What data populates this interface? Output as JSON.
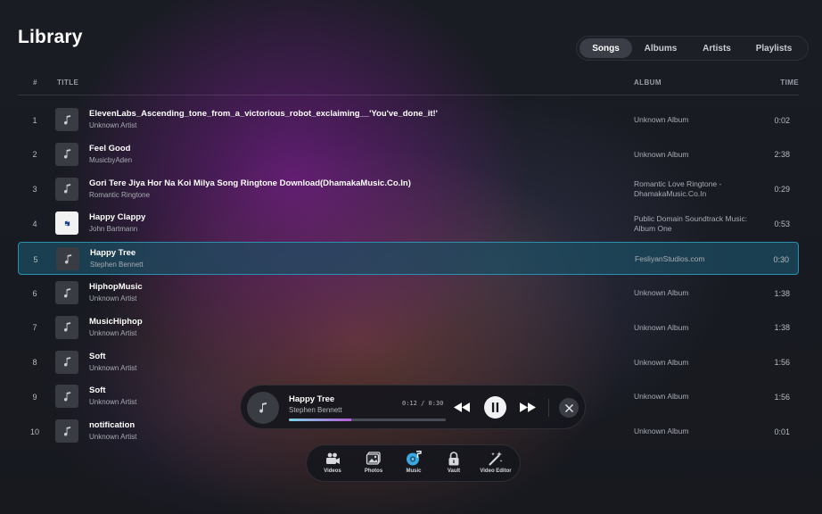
{
  "library": {
    "title": "Library"
  },
  "tabs": [
    {
      "label": "Songs",
      "active": true
    },
    {
      "label": "Albums",
      "active": false
    },
    {
      "label": "Artists",
      "active": false
    },
    {
      "label": "Playlists",
      "active": false
    }
  ],
  "columns": {
    "num": "#",
    "title": "TITLE",
    "album": "ALBUM",
    "time": "TIME"
  },
  "tracks": [
    {
      "num": "1",
      "title": "ElevenLabs_Ascending_tone_from_a_victorious_robot_exclaiming__'You've_done_it!'",
      "artist": "Unknown Artist",
      "album": "Unknown Album",
      "time": "0:02",
      "selected": false,
      "artwork": "music-note-icon"
    },
    {
      "num": "2",
      "title": "Feel Good",
      "artist": "MusicbyAden",
      "album": "Unknown Album",
      "time": "2:38",
      "selected": false,
      "artwork": "music-note-icon"
    },
    {
      "num": "3",
      "title": "Gori Tere Jiya Hor Na Koi Milya Song Ringtone Download(DhamakaMusic.Co.In)",
      "artist": "Romantic Ringtone",
      "album": "Romantic Love Ringtone - DhamakaMusic.Co.In",
      "time": "0:29",
      "selected": false,
      "artwork": "music-note-icon"
    },
    {
      "num": "4",
      "title": "Happy Clappy",
      "artist": "John Bartmann",
      "album": "Public Domain Soundtrack Music: Album One",
      "time": "0:53",
      "selected": false,
      "artwork": "album-art-image"
    },
    {
      "num": "5",
      "title": "Happy Tree",
      "artist": "Stephen Bennett",
      "album": "FesliyanStudios.com",
      "time": "0:30",
      "selected": true,
      "artwork": "music-note-icon"
    },
    {
      "num": "6",
      "title": "HiphopMusic",
      "artist": "Unknown Artist",
      "album": "Unknown Album",
      "time": "1:38",
      "selected": false,
      "artwork": "music-note-icon"
    },
    {
      "num": "7",
      "title": "MusicHiphop",
      "artist": "Unknown Artist",
      "album": "Unknown Album",
      "time": "1:38",
      "selected": false,
      "artwork": "music-note-icon"
    },
    {
      "num": "8",
      "title": "Soft",
      "artist": "Unknown Artist",
      "album": "Unknown Album",
      "time": "1:56",
      "selected": false,
      "artwork": "music-note-icon"
    },
    {
      "num": "9",
      "title": "Soft",
      "artist": "Unknown Artist",
      "album": "Unknown Album",
      "time": "1:56",
      "selected": false,
      "artwork": "music-note-icon"
    },
    {
      "num": "10",
      "title": "notification",
      "artist": "Unknown Artist",
      "album": "Unknown Album",
      "time": "0:01",
      "selected": false,
      "artwork": "music-note-icon"
    }
  ],
  "player": {
    "title": "Happy Tree",
    "artist": "Stephen Bennett",
    "time": "0:12 / 0:30",
    "progress": 0.4,
    "state": "playing"
  },
  "dock": [
    {
      "label": "Videos",
      "icon": "video-camera-icon",
      "active": false
    },
    {
      "label": "Photos",
      "icon": "photos-icon",
      "active": false
    },
    {
      "label": "Music",
      "icon": "music-disc-icon",
      "active": true
    },
    {
      "label": "Vault",
      "icon": "lock-icon",
      "active": false
    },
    {
      "label": "Video Editor",
      "icon": "magic-wand-icon",
      "active": false
    }
  ],
  "colors": {
    "accent": "#2b8fae",
    "selected_row_bg": "#1c4e62",
    "progress_start": "#7dd3e8",
    "progress_end": "#b45fd6",
    "active_dock": "#3aa7e0"
  }
}
